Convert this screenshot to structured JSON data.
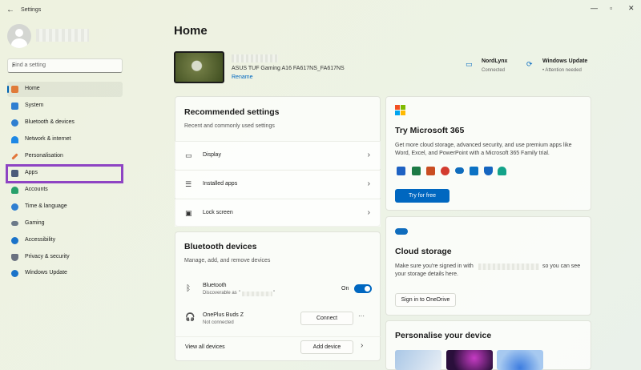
{
  "window": {
    "title": "Settings",
    "back_icon": "back-arrow-icon",
    "controls": [
      "minimize-icon",
      "maximize-icon",
      "close-icon"
    ]
  },
  "sidebar": {
    "search_placeholder": "Find a setting",
    "items": [
      {
        "label": "Home",
        "icon": "home-icon",
        "color": "#e07b39",
        "active": true
      },
      {
        "label": "System",
        "icon": "system-icon",
        "color": "#2f7fd1"
      },
      {
        "label": "Bluetooth & devices",
        "icon": "bluetooth-icon",
        "color": "#2f7fd1"
      },
      {
        "label": "Network & internet",
        "icon": "wifi-icon",
        "color": "#1e88e5"
      },
      {
        "label": "Personalisation",
        "icon": "brush-icon",
        "color": "#e2763a"
      },
      {
        "label": "Apps",
        "icon": "apps-icon",
        "color": "#4b5b7a"
      },
      {
        "label": "Accounts",
        "icon": "accounts-icon",
        "color": "#27a06b"
      },
      {
        "label": "Time & language",
        "icon": "globe-clock-icon",
        "color": "#2f7fd1"
      },
      {
        "label": "Gaming",
        "icon": "gaming-icon",
        "color": "#6c7a89"
      },
      {
        "label": "Accessibility",
        "icon": "accessibility-icon",
        "color": "#1a73c9"
      },
      {
        "label": "Privacy & security",
        "icon": "shield-icon",
        "color": "#6a7180"
      },
      {
        "label": "Windows Update",
        "icon": "update-icon",
        "color": "#1a73c9"
      }
    ]
  },
  "main": {
    "title": "Home",
    "device": {
      "model": "ASUS TUF Gaming A16 FA617NS_FA617NS",
      "rename_label": "Rename"
    },
    "status": [
      {
        "title": "NordLynx",
        "sub": "Connected",
        "icon": "ethernet-icon"
      },
      {
        "title": "Windows Update",
        "sub": "• Attention needed",
        "icon": "update-icon"
      }
    ],
    "recommended": {
      "title": "Recommended settings",
      "subtitle": "Recent and commonly used settings",
      "rows": [
        {
          "label": "Display",
          "icon": "monitor-icon"
        },
        {
          "label": "Installed apps",
          "icon": "list-icon"
        },
        {
          "label": "Lock screen",
          "icon": "lock-screen-icon"
        }
      ]
    },
    "bluetooth": {
      "title": "Bluetooth devices",
      "subtitle": "Manage, add, and remove devices",
      "bt_label": "Bluetooth",
      "bt_sub": "Discoverable as",
      "bt_quote_open": "\"",
      "bt_quote_close": "\"",
      "toggle_label": "On",
      "device_name": "OnePlus Buds Z",
      "device_status": "Not connected",
      "connect_label": "Connect",
      "more_label": "···",
      "view_all_label": "View all devices",
      "add_device_label": "Add device"
    },
    "m365": {
      "title": "Try Microsoft 365",
      "text": "Get more cloud storage, advanced security, and use premium apps like Word, Excel, and PowerPoint with a Microsoft 365 Family trial.",
      "button": "Try for free",
      "app_colors": [
        "#1e62c3",
        "#1d7a45",
        "#c94d22",
        "#d33b2f",
        "#0f6cbd",
        "#0c72c4",
        "#1565c0",
        "#13a38a"
      ]
    },
    "cloud": {
      "title": "Cloud storage",
      "text_part1": "Make sure you're signed in with",
      "text_part2": "so you can see your storage details here.",
      "button": "Sign in to OneDrive"
    },
    "personalise": {
      "title": "Personalise your device"
    }
  }
}
